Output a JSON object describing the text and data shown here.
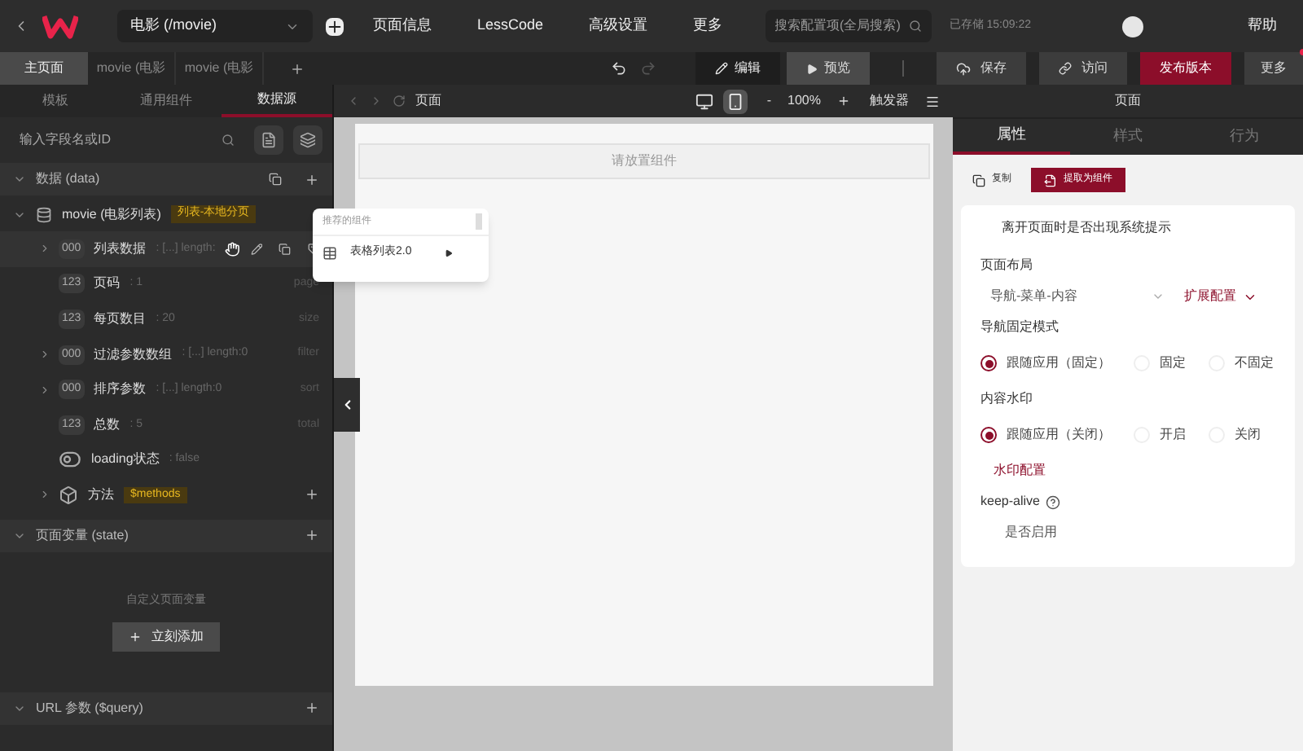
{
  "topbar": {
    "page_select": "电影 (/movie)",
    "menu": [
      "页面信息",
      "LessCode",
      "高级设置",
      "更多"
    ],
    "search": {
      "placeholder": "搜索配置项(全局搜索)"
    },
    "saved": "已存储 15:09:22",
    "help": "帮助"
  },
  "page_tabs": [
    {
      "label": "主页面",
      "selected": true
    },
    {
      "label": "movie (电影",
      "selected": false
    },
    {
      "label": "movie (电影",
      "selected": false
    }
  ],
  "toolbar": {
    "modes": [
      {
        "label": "编辑",
        "selected": true
      },
      {
        "label": "预览",
        "selected": false
      }
    ],
    "save": "保存",
    "visit": "访问",
    "publish": "发布版本",
    "more": "更多"
  },
  "left_tabs": [
    {
      "label": "模板",
      "selected": false
    },
    {
      "label": "通用组件",
      "selected": false
    },
    {
      "label": "数据源",
      "selected": true
    }
  ],
  "field_search": {
    "placeholder": "输入字段名或ID"
  },
  "data_section": {
    "title": "数据 (data)",
    "source": {
      "name": "movie (电影列表)",
      "tag": "列表-本地分页"
    },
    "fields": [
      {
        "kind": "array",
        "badge": "000",
        "name": "列表数据",
        "meta": ": [...] length:",
        "expandable": true,
        "hovered": true
      },
      {
        "kind": "number",
        "badge": "123",
        "name": "页码",
        "meta": ": 1",
        "key": "page",
        "expandable": false,
        "hovered": false
      },
      {
        "kind": "number",
        "badge": "123",
        "name": "每页数目",
        "meta": ": 20",
        "key": "size",
        "expandable": false,
        "hovered": false
      },
      {
        "kind": "array",
        "badge": "000",
        "name": "过滤参数数组",
        "meta": ": [...] length:0",
        "key": "filter",
        "expandable": true,
        "hovered": false
      },
      {
        "kind": "array",
        "badge": "000",
        "name": "排序参数",
        "meta": ": [...] length:0",
        "key": "sort",
        "expandable": true,
        "hovered": false
      },
      {
        "kind": "number",
        "badge": "123",
        "name": "总数",
        "meta": ": 5",
        "key": "total",
        "expandable": false,
        "hovered": false
      },
      {
        "kind": "boolean",
        "name": "loading状态",
        "meta": ": false",
        "expandable": false,
        "hovered": false
      },
      {
        "kind": "methods",
        "name": "方法",
        "meta": "$methods",
        "expandable": true,
        "hovered": false
      }
    ]
  },
  "state_section": {
    "title": "页面变量 (state)",
    "empty_text": "自定义页面变量",
    "add_button": "立刻添加"
  },
  "query_section": {
    "title": "URL 参数 ($query)"
  },
  "canvas": {
    "breadcrumb": "页面",
    "zoom": "100%",
    "zoom_out": "-",
    "trigger": "触发器",
    "devices": [
      {
        "kind": "desktop",
        "selected": false
      },
      {
        "kind": "mobile",
        "selected": true
      }
    ],
    "dropzone": "请放置组件",
    "popup": {
      "title": "推荐的组件",
      "item": "表格列表2.0"
    }
  },
  "right_panel": {
    "title": "页面",
    "tabs": [
      {
        "label": "属性",
        "selected": true
      },
      {
        "label": "样式",
        "selected": false
      },
      {
        "label": "行为",
        "selected": false
      }
    ],
    "copy": "复制",
    "extract": "提取为组件",
    "leave_prompt": "离开页面时是否出现系统提示",
    "layout_label": "页面布局",
    "layout_value": "导航-菜单-内容",
    "extend": "扩展配置",
    "nav_label": "导航固定模式",
    "nav_options": [
      {
        "label": "跟随应用（固定）",
        "selected": true
      },
      {
        "label": "固定",
        "selected": false
      },
      {
        "label": "不固定",
        "selected": false
      }
    ],
    "wm_label": "内容水印",
    "wm_options": [
      {
        "label": "跟随应用（关闭）",
        "selected": true
      },
      {
        "label": "开启",
        "selected": false
      },
      {
        "label": "关闭",
        "selected": false
      }
    ],
    "wm_config": "水印配置",
    "keepalive_label": "keep-alive",
    "keepalive_option": "是否启用"
  }
}
